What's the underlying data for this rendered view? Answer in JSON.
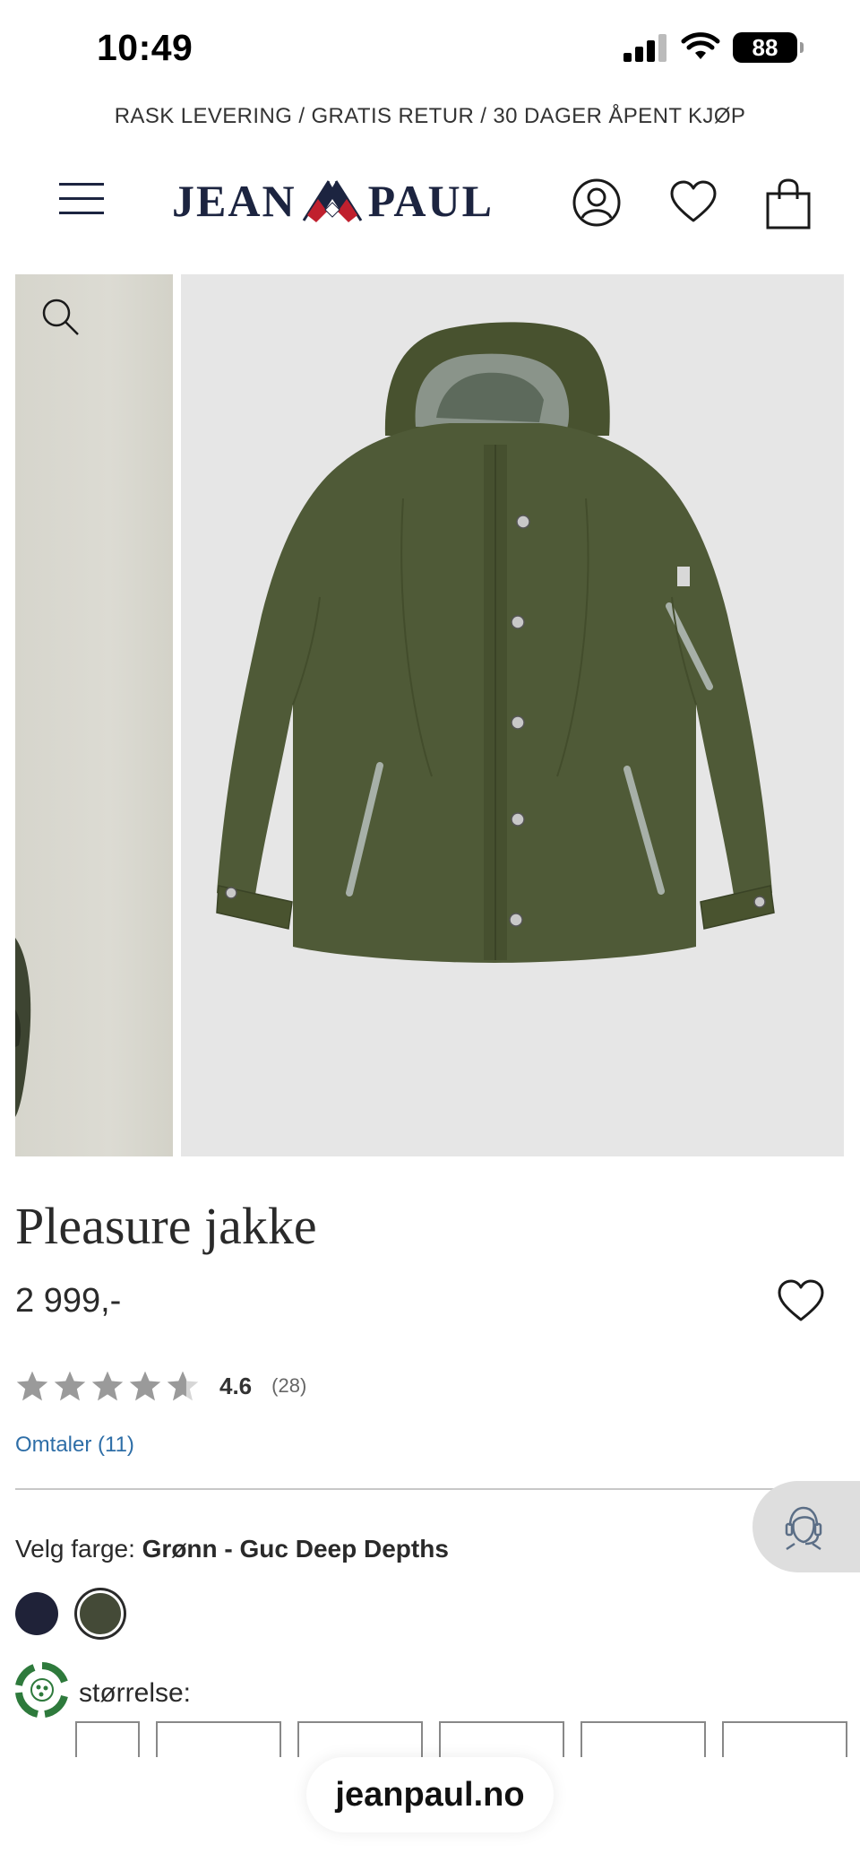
{
  "status_bar": {
    "time": "10:49",
    "battery": "88"
  },
  "promo": {
    "text": "RASK LEVERING / GRATIS RETUR / 30 DAGER ÅPENT KJØP"
  },
  "header": {
    "logo_left": "JEAN",
    "logo_right": "PAUL"
  },
  "product": {
    "title": "Pleasure jakke",
    "price": "2 999,-",
    "rating_value": "4.6",
    "rating_count": "(28)",
    "rating_stars": 4.6,
    "reviews_link": "Omtaler (11)",
    "color_prefix": "Velg farge: ",
    "color_name": "Grønn - Guc Deep Depths",
    "size_label": "størrelse:",
    "swatches": [
      {
        "name": "navy",
        "color": "#1f2238"
      },
      {
        "name": "green",
        "color": "#444a37",
        "selected": true
      }
    ]
  },
  "browser": {
    "url": "jeanpaul.no"
  },
  "colors": {
    "brand_navy": "#1c2440",
    "accent_red": "#c0202e",
    "link_blue": "#2e6ea7",
    "jacket_green": "#4f5a37"
  },
  "icons": [
    "menu-icon",
    "user-icon",
    "heart-icon",
    "bag-icon",
    "search-icon",
    "chat-support-icon",
    "recycle-icon"
  ]
}
